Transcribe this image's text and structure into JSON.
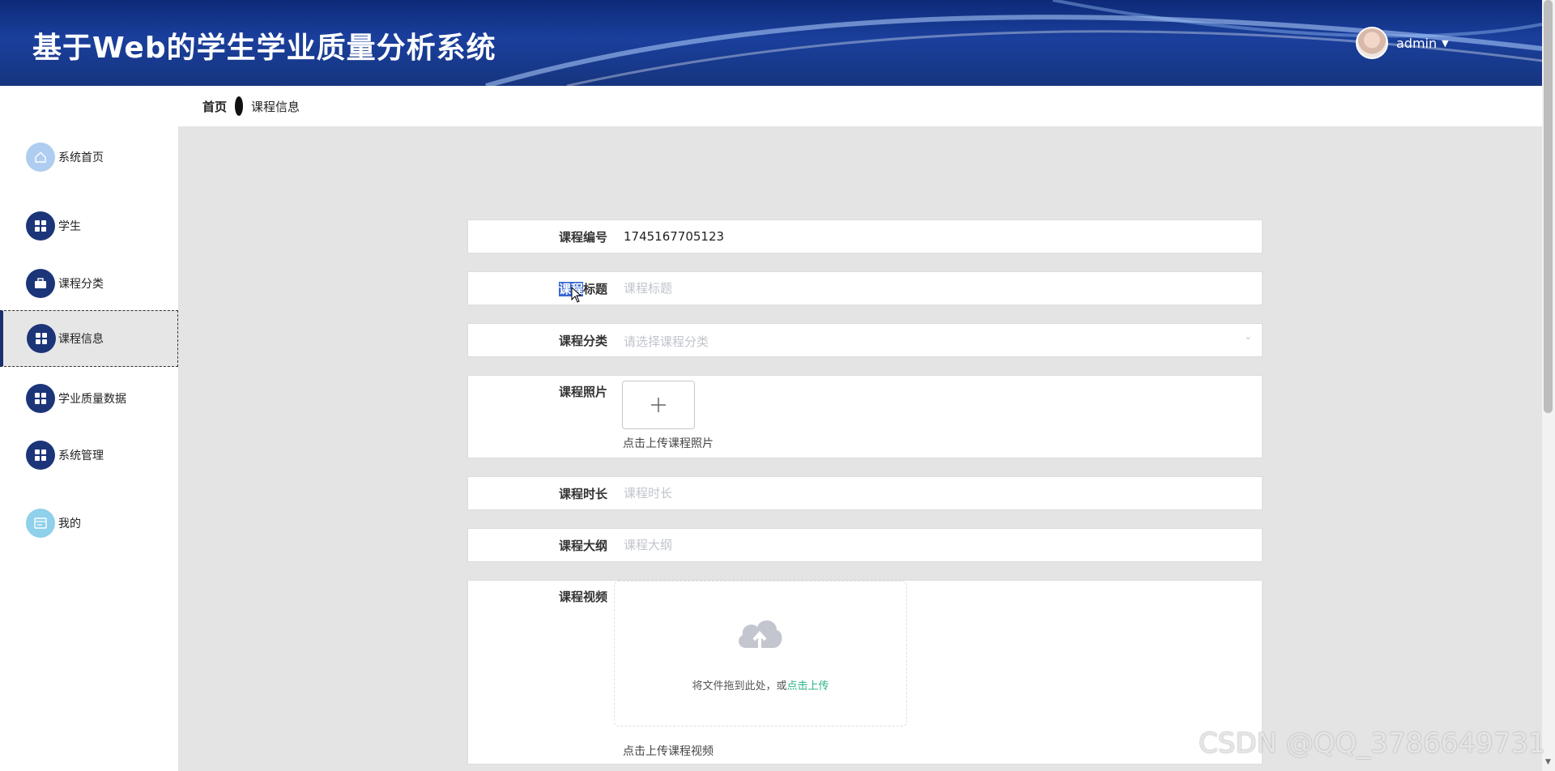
{
  "header": {
    "title": "基于Web的学生学业质量分析系统",
    "username": "admin",
    "caret": "▼"
  },
  "breadcrumb": {
    "home": "首页",
    "current": "课程信息"
  },
  "sidebar": {
    "items": [
      {
        "label": "系统首页",
        "icon": "home-icon"
      },
      {
        "label": "学生",
        "icon": "grid-icon"
      },
      {
        "label": "课程分类",
        "icon": "briefcase-icon"
      },
      {
        "label": "课程信息",
        "icon": "grid-icon",
        "active": true
      },
      {
        "label": "学业质量数据",
        "icon": "grid-icon"
      },
      {
        "label": "系统管理",
        "icon": "grid-icon"
      },
      {
        "label": "我的",
        "icon": "profile-card-icon"
      }
    ]
  },
  "form": {
    "course_no": {
      "label": "课程编号",
      "value": "1745167705123"
    },
    "course_title": {
      "label_hl": "课程",
      "label_rest": "标题",
      "placeholder": "课程标题"
    },
    "course_category": {
      "label": "课程分类",
      "placeholder": "请选择课程分类",
      "arrow": "⌄"
    },
    "course_photo": {
      "label": "课程照片",
      "plus": "+",
      "tip": "点击上传课程照片"
    },
    "course_duration": {
      "label": "课程时长",
      "placeholder": "课程时长"
    },
    "course_outline": {
      "label": "课程大纲",
      "placeholder": "课程大纲"
    },
    "course_video": {
      "label": "课程视频",
      "drop_text": "将文件拖到此处，或",
      "drop_link": "点击上传",
      "tip": "点击上传课程视频"
    }
  },
  "watermark": "CSDN @QQ_3786649731",
  "colors": {
    "header_blue": "#16357f",
    "menu_icon_dark": "#1c3578",
    "link_green": "#2bb38a",
    "selection_blue": "#3567d4"
  }
}
